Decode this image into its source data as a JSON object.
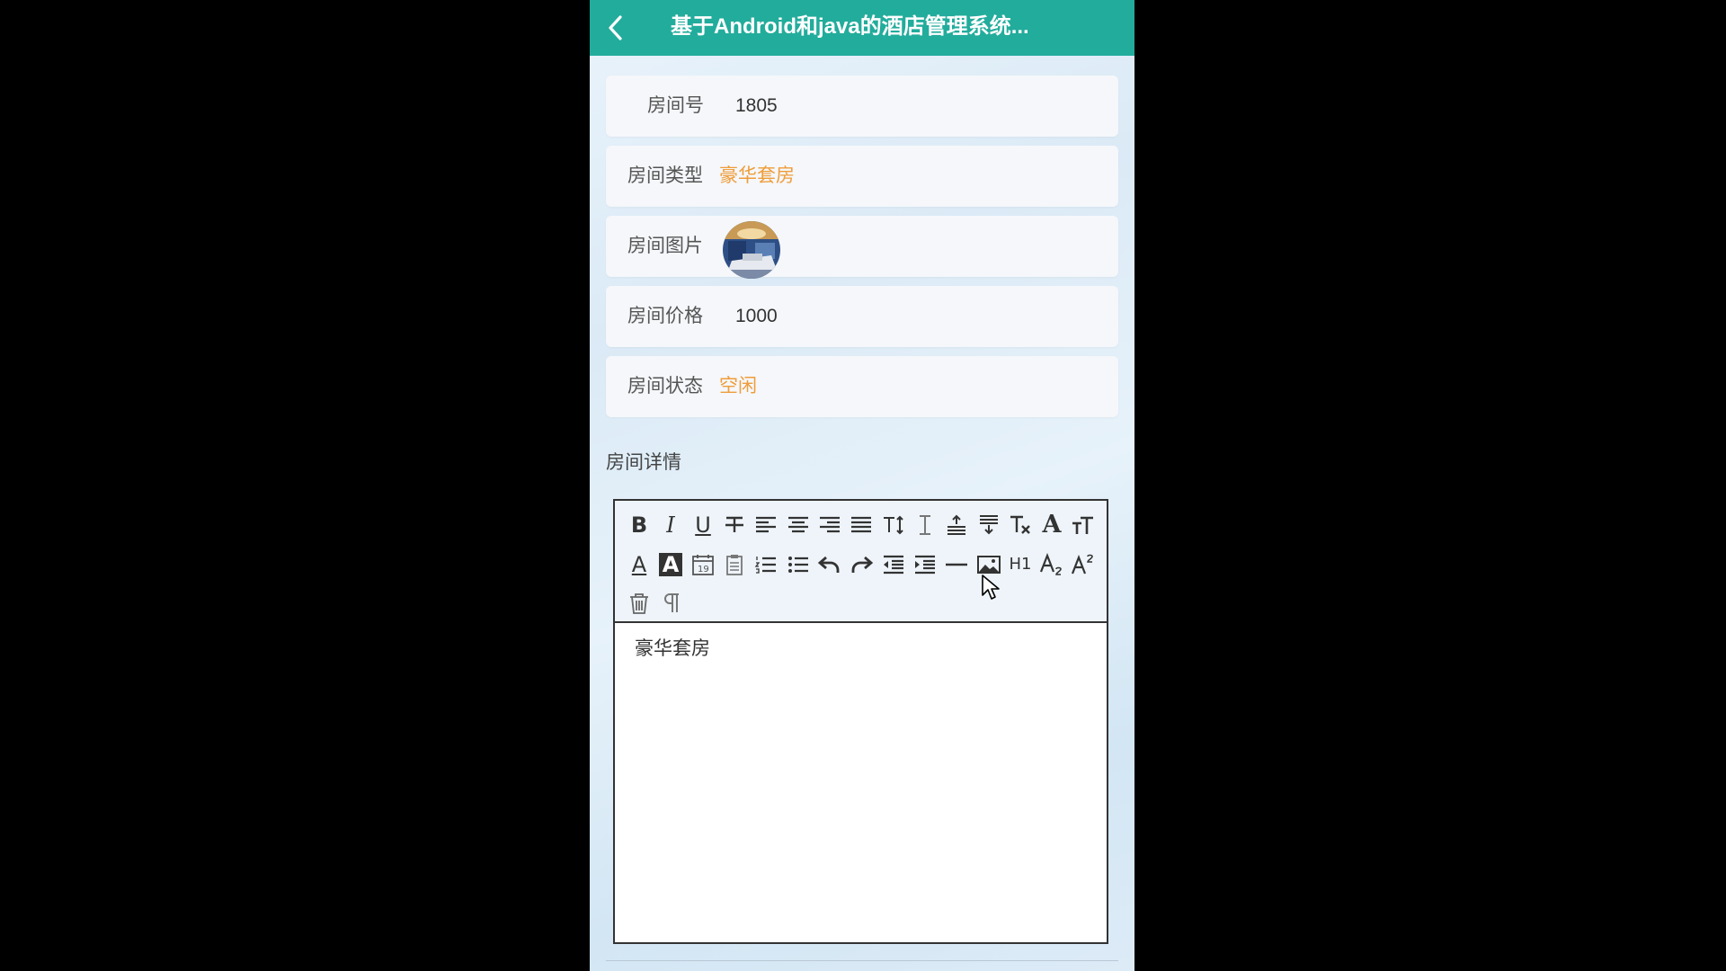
{
  "app": {
    "title": "基于Android和java的酒店管理系统..."
  },
  "fields": {
    "room_no": {
      "label": "房间号",
      "value": "1805"
    },
    "room_type": {
      "label": "房间类型",
      "value": "豪华套房"
    },
    "room_image": {
      "label": "房间图片"
    },
    "room_price": {
      "label": "房间价格",
      "value": "1000"
    },
    "room_status": {
      "label": "房间状态",
      "value": "空闲"
    }
  },
  "detail": {
    "label": "房间详情",
    "content": "豪华套房",
    "toolbar_texts": {
      "bold": "B",
      "italic": "I",
      "underline": "U",
      "font_color": "A",
      "bg_color": "A",
      "font_size": "A",
      "heading": "H1"
    }
  },
  "colors": {
    "topbar": "#22ac9c",
    "accent": "#ef9d3a"
  },
  "icons": [
    "chevron-left-icon",
    "strikethrough-icon",
    "align-left-icon",
    "align-center-icon",
    "align-right-icon",
    "align-justify-icon",
    "line-height-icon",
    "letter-spacing-icon",
    "paragraph-spacing-up-icon",
    "paragraph-spacing-down-icon",
    "clear-format-icon",
    "font-size-icon",
    "date-icon",
    "paste-icon",
    "ordered-list-icon",
    "unordered-list-icon",
    "undo-icon",
    "redo-icon",
    "outdent-icon",
    "indent-icon",
    "horizontal-rule-icon",
    "image-icon",
    "subscript-icon",
    "superscript-icon",
    "trash-icon",
    "paragraph-icon"
  ]
}
